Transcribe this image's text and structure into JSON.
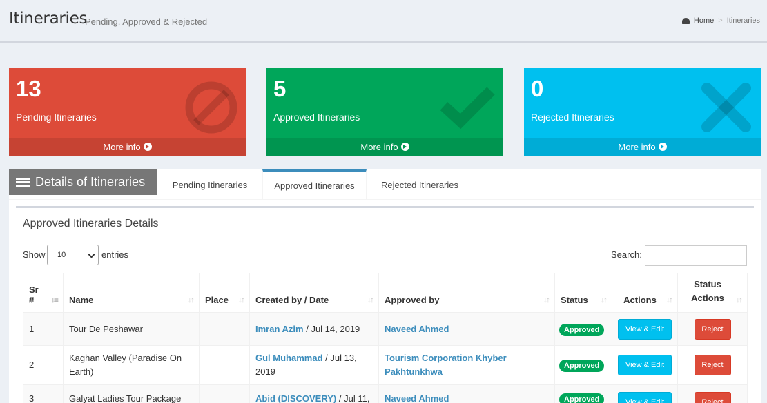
{
  "header": {
    "title": "Itineraries",
    "subtitle": "Pending, Approved & Rejected",
    "breadcrumb": {
      "home": "Home",
      "current": "Itineraries"
    }
  },
  "stat_boxes": [
    {
      "count": "13",
      "label": "Pending Itineraries",
      "more": "More info",
      "icon": "ban-icon",
      "color": "#dd4b39"
    },
    {
      "count": "5",
      "label": "Approved Itineraries",
      "more": "More info",
      "icon": "check-icon",
      "color": "#00a65a"
    },
    {
      "count": "0",
      "label": "Rejected Itineraries",
      "more": "More info",
      "icon": "times-icon",
      "color": "#00c0ef"
    }
  ],
  "tabs": {
    "header": "Details of Itineraries",
    "items": [
      "Pending Itineraries",
      "Approved Itineraries",
      "Rejected Itineraries"
    ],
    "active": "Approved Itineraries"
  },
  "panel": {
    "title": "Approved Itineraries Details",
    "show_label": "Show",
    "page_length": "10",
    "entries_label": "entries",
    "search_label": "Search:",
    "search_value": ""
  },
  "table": {
    "columns": [
      "Sr #",
      "Name",
      "Place",
      "Created by / Date",
      "Approved by",
      "Status",
      "Actions",
      "Status Actions"
    ],
    "rows": [
      {
        "sr": "1",
        "name": "Tour De Peshawar",
        "place": "",
        "created_by": "Imran Azim",
        "date": "/ Jul 14, 2019",
        "approved_by": "Naveed Ahmed",
        "status": "Approved",
        "action": "View & Edit",
        "status_action": "Reject"
      },
      {
        "sr": "2",
        "name": "Kaghan Valley (Paradise On Earth)",
        "place": "",
        "created_by": "Gul Muhammad",
        "date": "/ Jul 13, 2019",
        "approved_by": "Tourism Corporation Khyber Pakhtunkhwa",
        "status": "Approved",
        "action": "View & Edit",
        "status_action": "Reject"
      },
      {
        "sr": "3",
        "name": "Galyat Ladies Tour Package",
        "place": "",
        "created_by": "Abid (DISCOVERY)",
        "date": "/ Jul 11,",
        "approved_by": "Naveed Ahmed",
        "status": "Approved",
        "action": "View & Edit",
        "status_action": "Reject"
      }
    ]
  }
}
